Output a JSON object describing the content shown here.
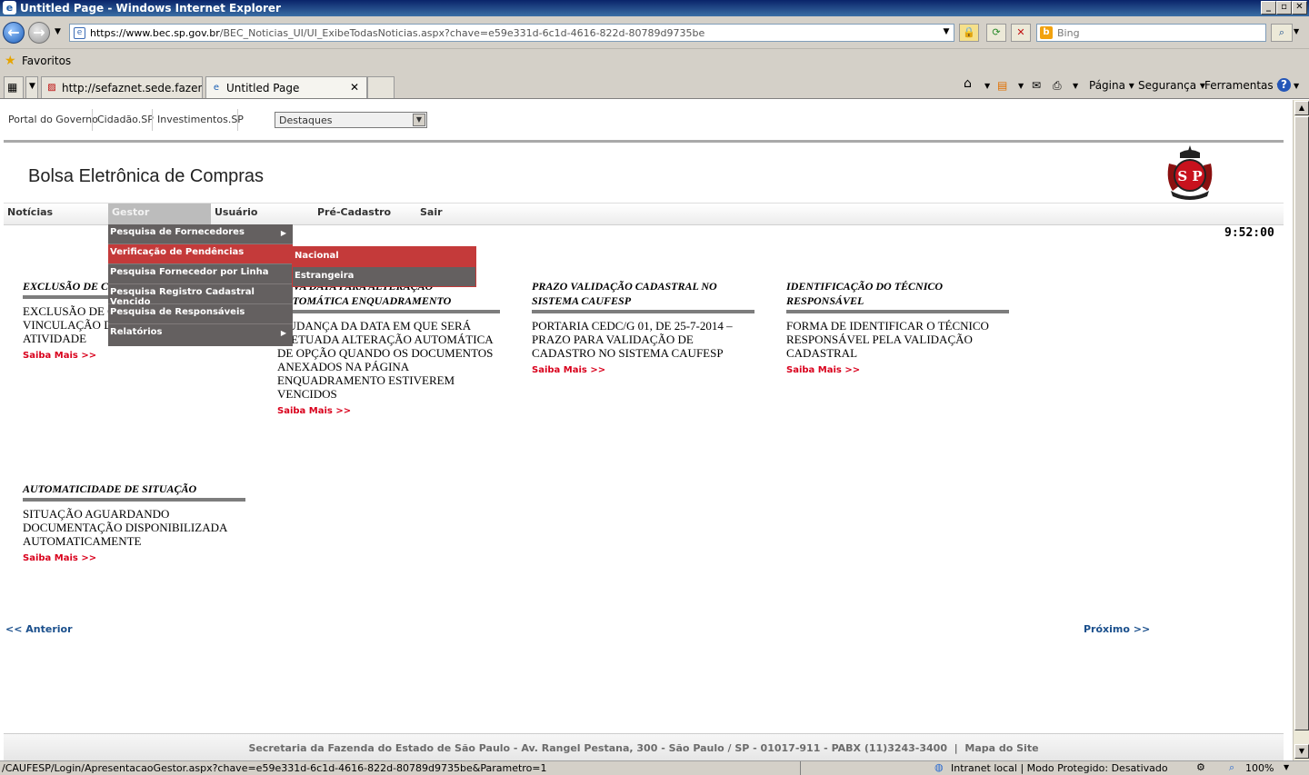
{
  "window": {
    "title": "Untitled Page - Windows Internet Explorer",
    "address_host": "https://www.bec.sp.gov.br",
    "address_path": "/BEC_Noticias_UI/UI_ExibeTodasNoticias.aspx?chave=e59e331d-6c1d-4616-822d-80789d9735be",
    "search_placeholder": "Bing",
    "favorites_label": "Favoritos",
    "tabs": [
      {
        "label": "http://sefaznet.sede.fazend..."
      },
      {
        "label": "Untitled Page"
      }
    ],
    "commands": {
      "page": "Página ▾",
      "security": "Segurança ▾",
      "tools": "Ferramentas ▾"
    }
  },
  "site": {
    "top_links": [
      "Portal do Governo",
      "Cidadão.SP",
      "Investimentos.SP"
    ],
    "select_value": "Destaques",
    "title": "Bolsa Eletrônica de Compras",
    "logo_text": "SP",
    "menu": [
      "Notícias",
      "Gestor",
      "Usuário",
      "Pré-Cadastro",
      "Sair"
    ],
    "clock": "9:52:00",
    "gestor_menu": [
      {
        "label": "Pesquisa de Fornecedores",
        "has_sub": true
      },
      {
        "label": "Verificação de Pendências",
        "has_sub": false
      },
      {
        "label": "Pesquisa Fornecedor por Linha",
        "has_sub": false
      },
      {
        "label": "Pesquisa Registro Cadastral Vencido",
        "has_sub": false
      },
      {
        "label": "Pesquisa de Responsáveis",
        "has_sub": false
      },
      {
        "label": "Relatórios",
        "has_sub": true
      }
    ],
    "submenu": [
      "Nacional",
      "Estrangeira"
    ]
  },
  "news": [
    {
      "title": "EXCLUSÃO DE CLASSE / FORNECIMENTO",
      "body": "EXCLUSÃO DE CLASSE DE VINCULAÇÃO DE FORNECIMENTO À ATIVIDADE",
      "more": "Saiba Mais >>"
    },
    {
      "title": "NOVA DATA PARA ALTERAÇÃO AUTOMÁTICA ENQUADRAMENTO",
      "body": "MUDANÇA DA DATA EM QUE SERÁ EFETUADA ALTERAÇÃO AUTOMÁTICA DE OPÇÃO QUANDO OS DOCUMENTOS ANEXADOS NA PÁGINA ENQUADRAMENTO ESTIVEREM VENCIDOS",
      "more": "Saiba Mais >>"
    },
    {
      "title": "PRAZO VALIDAÇÃO CADASTRAL NO SISTEMA CAUFESP",
      "body": "PORTARIA CEDC/G 01, DE 25-7-2014 – PRAZO PARA VALIDAÇÃO DE CADASTRO NO SISTEMA CAUFESP",
      "more": "Saiba Mais >>"
    },
    {
      "title": "IDENTIFICAÇÃO DO TÉCNICO RESPONSÁVEL",
      "body": "FORMA DE IDENTIFICAR O TÉCNICO RESPONSÁVEL PELA VALIDAÇÃO CADASTRAL",
      "more": "Saiba Mais >>"
    },
    {
      "title": "AUTOMATICIDADE DE SITUAÇÃO",
      "body": "SITUAÇÃO AGUARDANDO DOCUMENTAÇÃO DISPONIBILIZADA AUTOMATICAMENTE",
      "more": "Saiba Mais >>"
    }
  ],
  "pager": {
    "prev": "<< Anterior",
    "next": "Próximo >>"
  },
  "footer": {
    "address": "Secretaria da Fazenda do Estado de São Paulo - Av. Rangel Pestana, 300 - São Paulo / SP - 01017-911 - PABX (11)3243-3400",
    "sep": "|",
    "sitemap": "Mapa do Site"
  },
  "status": {
    "url": "/CAUFESP/Login/ApresentacaoGestor.aspx?chave=e59e331d-6c1d-4616-822d-80789d9735be&Parametro=1",
    "zone": "Intranet local | Modo Protegido: Desativado",
    "zoom": "100%"
  }
}
